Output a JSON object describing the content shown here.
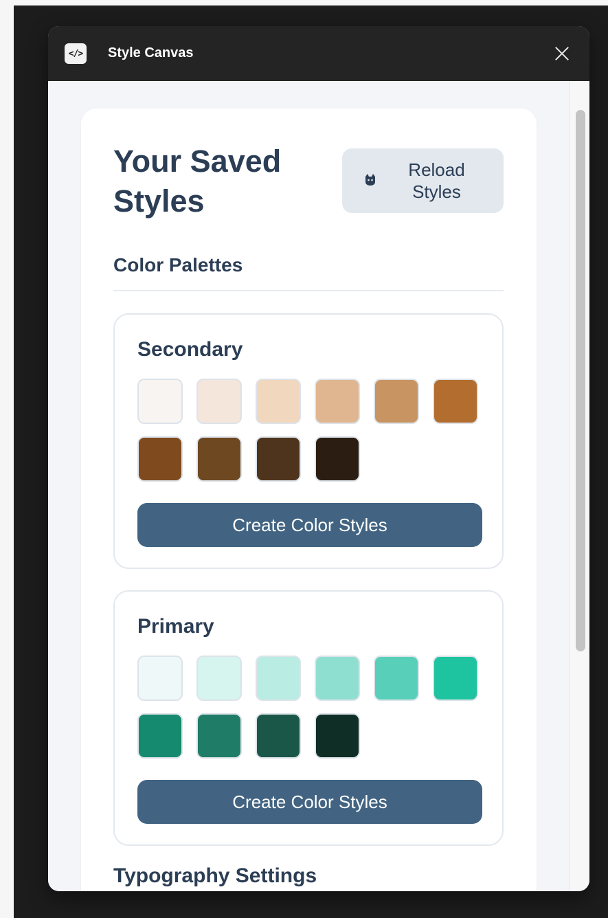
{
  "window": {
    "title": "Style Canvas",
    "app_icon_glyph": "</>",
    "close_icon": "close-icon"
  },
  "header": {
    "title": "Your Saved Styles",
    "reload_button": {
      "label": "Reload Styles",
      "icon": "cat-icon"
    }
  },
  "sections": {
    "color_palettes": "Color Palettes",
    "typography": "Typography Settings"
  },
  "palettes": [
    {
      "name": "Secondary",
      "swatches": [
        "#f8f4f1",
        "#f5e6dc",
        "#f1d7bd",
        "#e0b690",
        "#c89462",
        "#b36d2f",
        "#7f4a1e",
        "#6e4820",
        "#4e341c",
        "#2b1d12"
      ],
      "button_label": "Create Color Styles"
    },
    {
      "name": "Primary",
      "swatches": [
        "#eff8f8",
        "#d5f5ee",
        "#b9ede3",
        "#8fdfd0",
        "#58cfb8",
        "#1ec39f",
        "#168a6e",
        "#1e7c67",
        "#1b5748",
        "#0f2e26"
      ],
      "button_label": "Create Color Styles"
    }
  ],
  "colors": {
    "heading": "#2c3e55",
    "button": "#426482",
    "titlebar": "#242424"
  }
}
